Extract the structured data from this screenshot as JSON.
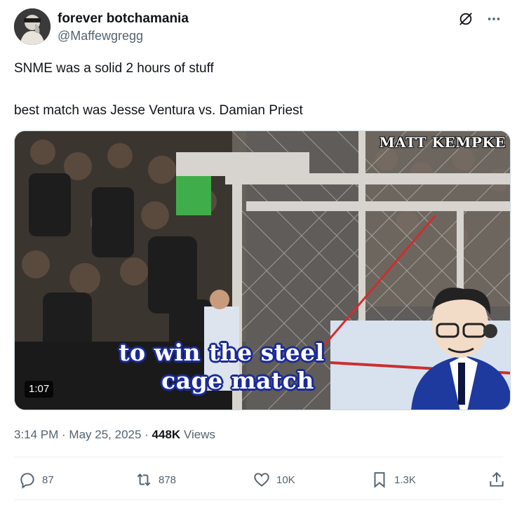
{
  "author": {
    "display_name": "forever botchamania",
    "handle": "@Maffewgregg",
    "avatar_icon": "avatar-photo"
  },
  "header_icons": [
    "grok-icon",
    "more-icon"
  ],
  "more_label": "···",
  "tweet": {
    "line1": "SNME was a solid 2 hours of stuff",
    "line2": "best match was Jesse Ventura vs. Damian Priest"
  },
  "media": {
    "watermark": "MATT KEMPKE",
    "caption_line1": "to win the steel",
    "caption_line2": "cage match",
    "duration": "1:07"
  },
  "meta": {
    "time": "3:14 PM",
    "separator": " · ",
    "date": "May 25, 2025",
    "views_count": "448K",
    "views_label": " Views"
  },
  "actions": {
    "replies": "87",
    "reposts": "878",
    "likes": "10K",
    "bookmarks": "1.3K"
  },
  "colors": {
    "text_primary": "#0f1419",
    "text_secondary": "#536471",
    "caption_outline": "#1a2a9a"
  }
}
